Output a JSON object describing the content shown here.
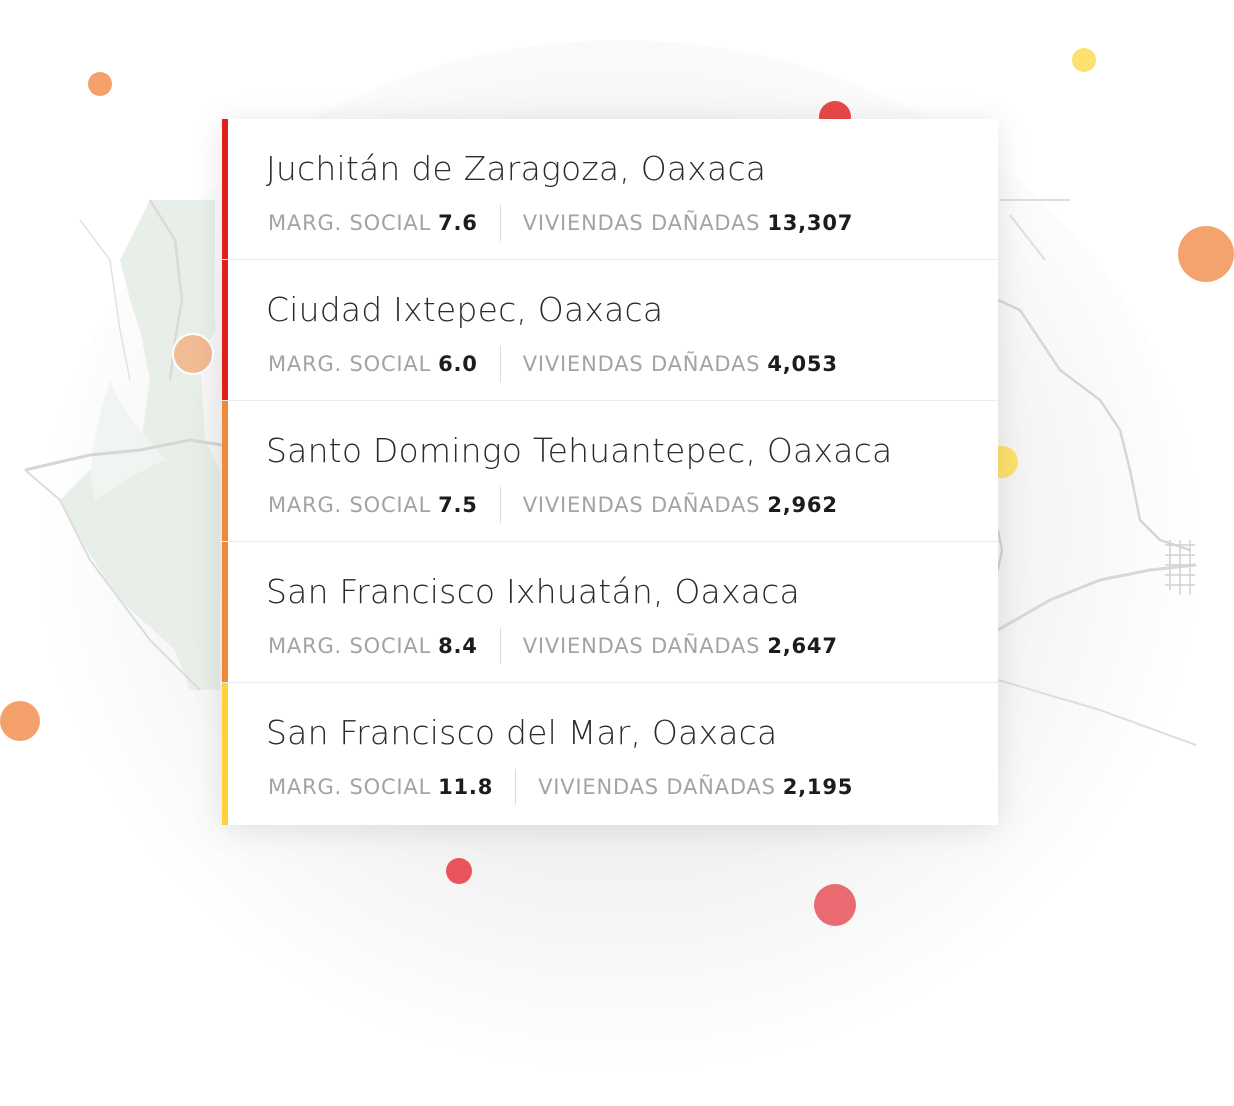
{
  "stat_labels": {
    "marg_social": "MARG. SOCIAL",
    "viviendas": "VIVIENDAS DAÑADAS"
  },
  "colors": {
    "red": "#e0201f",
    "orange": "#f08a3a",
    "yellow": "#fdd33a"
  },
  "places": [
    {
      "name": "Juchitán de Zaragoza, Oaxaca",
      "marg_social": "7.6",
      "viviendas": "13,307",
      "severity": "red"
    },
    {
      "name": "Ciudad Ixtepec, Oaxaca",
      "marg_social": "6.0",
      "viviendas": "4,053",
      "severity": "red"
    },
    {
      "name": "Santo Domingo Tehuantepec, Oaxaca",
      "marg_social": "7.5",
      "viviendas": "2,962",
      "severity": "orange"
    },
    {
      "name": "San Francisco Ixhuatán, Oaxaca",
      "marg_social": "8.4",
      "viviendas": "2,647",
      "severity": "orange"
    },
    {
      "name": "San Francisco del Mar, Oaxaca",
      "marg_social": "11.8",
      "viviendas": "2,195",
      "severity": "yellow"
    }
  ]
}
